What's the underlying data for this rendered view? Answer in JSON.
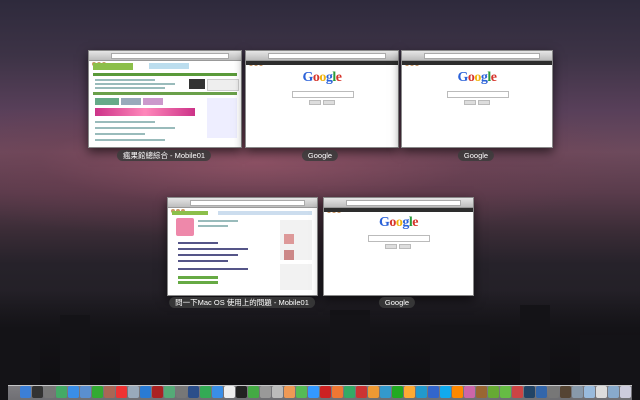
{
  "windows": [
    {
      "id": "w1",
      "title": "瘋果館總綜合 - Mobile01",
      "kind": "mobile01-forum"
    },
    {
      "id": "w2",
      "title": "Google",
      "kind": "google"
    },
    {
      "id": "w3",
      "title": "Google",
      "kind": "google"
    },
    {
      "id": "w4",
      "title": "問一下Mac OS 使用上的問題 - Mobile01",
      "kind": "mobile01-thread"
    },
    {
      "id": "w5",
      "title": "Google",
      "kind": "google"
    }
  ],
  "google": {
    "logo": [
      "G",
      "o",
      "o",
      "g",
      "l",
      "e"
    ]
  },
  "dock": {
    "icons": [
      {
        "name": "finder-icon",
        "color": "#3c7fd6"
      },
      {
        "name": "dashboard-icon",
        "color": "#333"
      },
      {
        "name": "launchpad-icon",
        "color": "#777"
      },
      {
        "name": "mission-control-icon",
        "color": "#4a6"
      },
      {
        "name": "safari-icon",
        "color": "#3a8ee6"
      },
      {
        "name": "mail-icon",
        "color": "#5a8fd0"
      },
      {
        "name": "facetime-icon",
        "color": "#3a3"
      },
      {
        "name": "address-book-icon",
        "color": "#a65"
      },
      {
        "name": "ical-icon",
        "color": "#e33"
      },
      {
        "name": "preview-icon",
        "color": "#9ab"
      },
      {
        "name": "itunes-icon",
        "color": "#2a7bd4"
      },
      {
        "name": "photo-booth-icon",
        "color": "#a22"
      },
      {
        "name": "iphoto-icon",
        "color": "#5a7"
      },
      {
        "name": "system-preferences-icon",
        "color": "#777"
      },
      {
        "name": "quicktime-icon",
        "color": "#2b4e8a"
      },
      {
        "name": "time-machine-icon",
        "color": "#3a5"
      },
      {
        "name": "app-store-icon",
        "color": "#3a8ee6"
      },
      {
        "name": "textedit-icon",
        "color": "#eee"
      },
      {
        "name": "terminal-icon",
        "color": "#222"
      },
      {
        "name": "activity-monitor-icon",
        "color": "#4a4"
      },
      {
        "name": "disk-utility-icon",
        "color": "#999"
      },
      {
        "name": "script-editor-icon",
        "color": "#bbb"
      },
      {
        "name": "pages-icon",
        "color": "#e95"
      },
      {
        "name": "numbers-icon",
        "color": "#5b5"
      },
      {
        "name": "keynote-icon",
        "color": "#39f"
      },
      {
        "name": "filezilla-icon",
        "color": "#c22"
      },
      {
        "name": "firefox-icon",
        "color": "#e73"
      },
      {
        "name": "dreamweaver-icon",
        "color": "#3a6"
      },
      {
        "name": "flash-icon",
        "color": "#c33"
      },
      {
        "name": "illustrator-icon",
        "color": "#e93"
      },
      {
        "name": "xcode-icon",
        "color": "#39c"
      },
      {
        "name": "excel-icon",
        "color": "#2a2"
      },
      {
        "name": "outlook-icon",
        "color": "#fa3"
      },
      {
        "name": "photoshop-icon",
        "color": "#29c"
      },
      {
        "name": "word-icon",
        "color": "#36c"
      },
      {
        "name": "skype-icon",
        "color": "#1ae"
      },
      {
        "name": "vlc-icon",
        "color": "#f80"
      },
      {
        "name": "colorsync-icon",
        "color": "#c6a"
      },
      {
        "name": "growl-icon",
        "color": "#963"
      },
      {
        "name": "spotify-icon",
        "color": "#6a3"
      },
      {
        "name": "evernote-icon",
        "color": "#6b4"
      },
      {
        "name": "transmission-icon",
        "color": "#c44"
      },
      {
        "name": "steam-icon",
        "color": "#246"
      },
      {
        "name": "virtualbox-icon",
        "color": "#36a"
      },
      {
        "name": "calculator-icon",
        "color": "#777"
      },
      {
        "name": "chess-icon",
        "color": "#543"
      },
      {
        "name": "image-capture-icon",
        "color": "#89a"
      },
      {
        "name": "downloads-stack-icon",
        "color": "#9bd"
      },
      {
        "name": "documents-stack-icon",
        "color": "#ddd"
      },
      {
        "name": "applications-stack-icon",
        "color": "#8ac"
      },
      {
        "name": "trash-icon",
        "color": "#ccd"
      }
    ]
  }
}
